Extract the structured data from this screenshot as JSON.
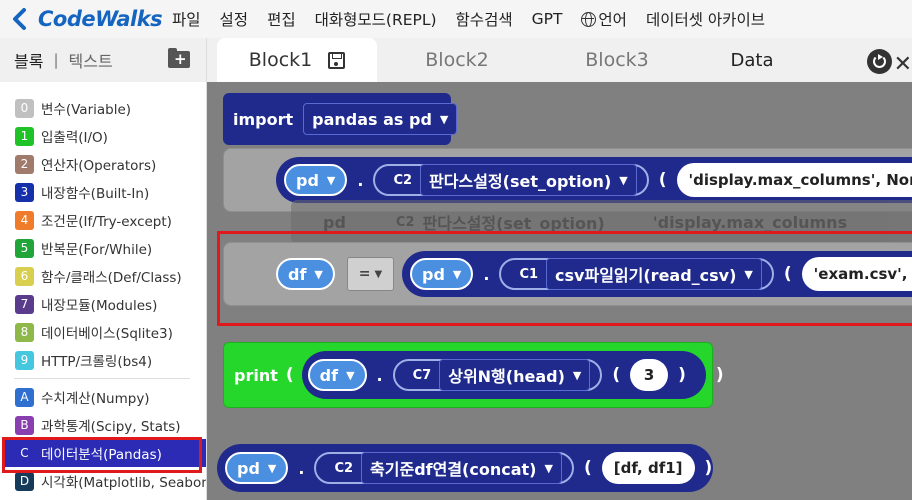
{
  "app": {
    "logo": "CodeWalks"
  },
  "menu": [
    "파일",
    "설정",
    "편집",
    "대화형모드(REPL)",
    "함수검색",
    "GPT",
    "언어",
    "데이터셋 아카이브"
  ],
  "left_panel": {
    "tab_blocks": "블록",
    "separator": "|",
    "tab_text": "텍스트",
    "categories": [
      {
        "num": "0",
        "label": "변수(Variable)",
        "color": "#c0c0c0"
      },
      {
        "num": "1",
        "label": "입출력(I/O)",
        "color": "#1fc227"
      },
      {
        "num": "2",
        "label": "연산자(Operators)",
        "color": "#a07a6a"
      },
      {
        "num": "3",
        "label": "내장함수(Built-In)",
        "color": "#1530a8"
      },
      {
        "num": "4",
        "label": "조건문(If/Try-except)",
        "color": "#f07b2a"
      },
      {
        "num": "5",
        "label": "반복문(For/While)",
        "color": "#22a538"
      },
      {
        "num": "6",
        "label": "함수/클래스(Def/Class)",
        "color": "#d9cf4e"
      },
      {
        "num": "7",
        "label": "내장모듈(Modules)",
        "color": "#5b3c8c"
      },
      {
        "num": "8",
        "label": "데이터베이스(Sqlite3)",
        "color": "#8fb84a"
      },
      {
        "num": "9",
        "label": "HTTP/크롤링(bs4)",
        "color": "#45c7e0"
      }
    ],
    "categories2": [
      {
        "num": "A",
        "label": "수치계산(Numpy)",
        "color": "#2f6fd0"
      },
      {
        "num": "B",
        "label": "과학통계(Scipy, Stats)",
        "color": "#8a3fb0"
      },
      {
        "num": "C",
        "label": "데이터분석(Pandas)",
        "color": "#2b2bb5"
      },
      {
        "num": "D",
        "label": "시각화(Matplotlib, Seaborn)",
        "color": "#153a5a"
      }
    ]
  },
  "tabs": [
    "Block1",
    "Block2",
    "Block3",
    "Data"
  ],
  "blocks": {
    "import": {
      "keyword": "import",
      "module": "pandas as pd"
    },
    "set_option": {
      "obj": "pd",
      "dot": ".",
      "code": "C2",
      "func": "판다스설정(set_option)",
      "paren": "(",
      "arg": "'display.max_columns', None"
    },
    "set_option_ghost": {
      "obj": "pd",
      "code": "C2",
      "func": "판다스설정(set_option)",
      "arg": "'display.max_columns"
    },
    "read_csv": {
      "var": "df",
      "eq": "=",
      "obj": "pd",
      "dot": ".",
      "code": "C1",
      "func": "csv파일읽기(read_csv)",
      "paren": "(",
      "arg": "'exam.csv', he"
    },
    "print": {
      "keyword": "print",
      "paren_open": "(",
      "obj": "df",
      "dot": ".",
      "code": "C7",
      "func": "상위N행(head)",
      "paren": "(",
      "arg": "3",
      "close": ")",
      "close2": ")"
    },
    "concat": {
      "obj": "pd",
      "dot": ".",
      "code": "C2",
      "func": "축기준df연결(concat)",
      "paren": "(",
      "arg": "[df, df1]",
      "close": ")"
    }
  }
}
